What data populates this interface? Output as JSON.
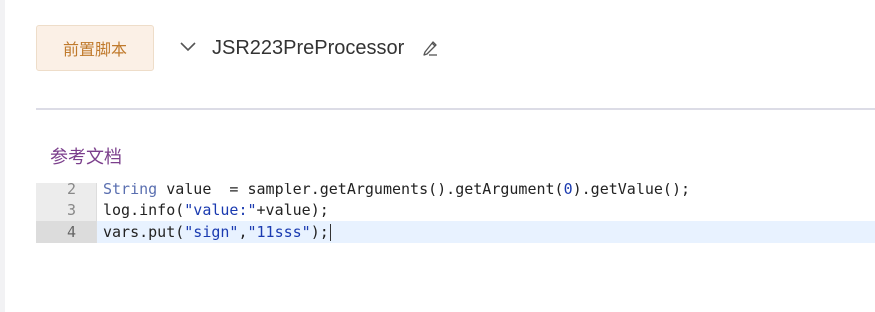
{
  "header": {
    "tag_label": "前置脚本",
    "processor_name": "JSR223PreProcessor"
  },
  "reference": {
    "label": "参考文档"
  },
  "editor": {
    "lines": [
      {
        "number": "2",
        "t1": "String",
        "t2": " value  = sampler.getArguments().getArgument(",
        "t3": "0",
        "t4": ").getValue();"
      },
      {
        "number": "3",
        "t1": "log.info(",
        "t2": "\"value:\"",
        "t3": "+value);"
      },
      {
        "number": "4",
        "t1": "vars.put(",
        "t2": "\"sign\"",
        "t3": ",",
        "t4": "\"11sss\"",
        "t5": ");"
      }
    ],
    "active_line": "4"
  },
  "colors": {
    "tag_bg": "#fbf0e6",
    "tag_text": "#c07a2c",
    "link": "#7b3f8c",
    "string": "#1a3ab0",
    "active_line_bg": "#e8f2ff"
  }
}
